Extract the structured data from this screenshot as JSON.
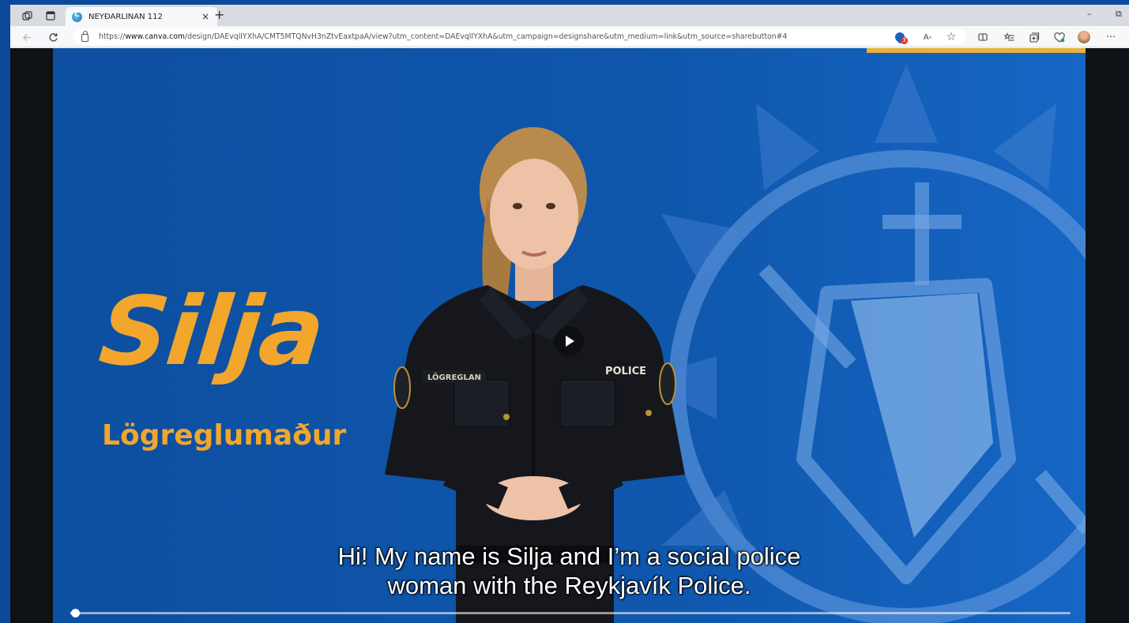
{
  "browser": {
    "tab_title": "NEYÐARLÍNAN 112",
    "tab_close": "×",
    "new_tab": "+",
    "minimize": "–",
    "restore": "⧉",
    "url_prefix": "https://",
    "url_host": "www.canva.com",
    "url_path": "/design/DAEvqlIYXhA/CMT5MTQNvH3nZtvEaxtpaA/view?utm_content=DAEvqlIYXhA&utm_campaign=designshare&utm_medium=link&utm_source=sharebutton#4",
    "extension_badge_count": "3",
    "icons": [
      "workspaces-icon",
      "tab-actions-icon",
      "back-icon",
      "refresh-icon",
      "lock-icon",
      "tracking-prevention-icon",
      "read-aloud-icon",
      "favorite-star-icon",
      "split-screen-icon",
      "favorites-icon",
      "collections-icon",
      "browser-essentials-icon",
      "profile-icon",
      "more-icon"
    ]
  },
  "slide": {
    "name": "Silja",
    "role": "Lögreglumaður",
    "uniform_left_patch": "LÖGREGLAN",
    "uniform_right_patch": "POLICE",
    "colors": {
      "background": "#0f57ad",
      "accent": "#f2a62b"
    }
  },
  "video": {
    "caption_line_1": "Hi! My name is Silja and I’m a social police",
    "caption_line_2": "woman with the Reykjavík Police.",
    "progress": 0.005
  }
}
